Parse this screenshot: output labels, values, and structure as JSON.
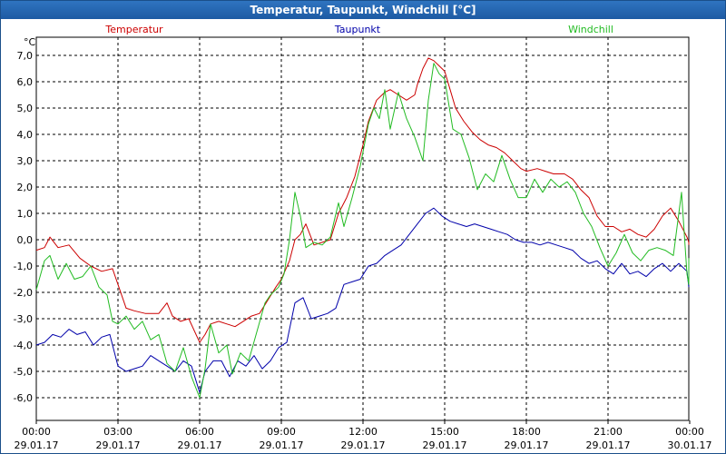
{
  "window": {
    "title": "Temperatur, Taupunkt, Windchill [°C]"
  },
  "chart_data": {
    "type": "line",
    "title": "Temperatur, Taupunkt, Windchill [°C]",
    "ylabel": "°C",
    "ylim": [
      -6.8,
      7.4
    ],
    "xlim_hours": [
      0,
      24
    ],
    "grid": true,
    "legend_position": "top",
    "y_ticks": [
      "7,0",
      "6,0",
      "5,0",
      "4,0",
      "3,0",
      "2,0",
      "1,0",
      "0,0",
      "-1,0",
      "-2,0",
      "-3,0",
      "-4,0",
      "-5,0",
      "-6,0"
    ],
    "y_tick_values": [
      7,
      6,
      5,
      4,
      3,
      2,
      1,
      0,
      -1,
      -2,
      -3,
      -4,
      -5,
      -6
    ],
    "x_ticks": [
      {
        "time": "00:00",
        "date": "29.01.17"
      },
      {
        "time": "03:00",
        "date": "29.01.17"
      },
      {
        "time": "06:00",
        "date": "29.01.17"
      },
      {
        "time": "09:00",
        "date": "29.01.17"
      },
      {
        "time": "12:00",
        "date": "29.01.17"
      },
      {
        "time": "15:00",
        "date": "29.01.17"
      },
      {
        "time": "18:00",
        "date": "29.01.17"
      },
      {
        "time": "21:00",
        "date": "29.01.17"
      },
      {
        "time": "00:00",
        "date": "30.01.17"
      }
    ],
    "series": [
      {
        "name": "Temperatur",
        "color": "#cc0000",
        "points": [
          [
            0,
            -0.4
          ],
          [
            0.3,
            -0.3
          ],
          [
            0.5,
            0.1
          ],
          [
            0.8,
            -0.3
          ],
          [
            1.2,
            -0.2
          ],
          [
            1.6,
            -0.7
          ],
          [
            2,
            -1
          ],
          [
            2.4,
            -1.2
          ],
          [
            2.8,
            -1.1
          ],
          [
            3,
            -1.7
          ],
          [
            3.3,
            -2.6
          ],
          [
            3.6,
            -2.7
          ],
          [
            4,
            -2.8
          ],
          [
            4.5,
            -2.8
          ],
          [
            4.8,
            -2.4
          ],
          [
            5,
            -2.9
          ],
          [
            5.3,
            -3.1
          ],
          [
            5.6,
            -3
          ],
          [
            6,
            -3.9
          ],
          [
            6.2,
            -3.6
          ],
          [
            6.4,
            -3.2
          ],
          [
            6.7,
            -3.1
          ],
          [
            7,
            -3.2
          ],
          [
            7.3,
            -3.3
          ],
          [
            7.6,
            -3.1
          ],
          [
            7.9,
            -2.9
          ],
          [
            8.2,
            -2.8
          ],
          [
            8.5,
            -2.3
          ],
          [
            8.8,
            -1.8
          ],
          [
            9,
            -1.5
          ],
          [
            9.3,
            -0.8
          ],
          [
            9.5,
            0
          ],
          [
            9.7,
            0.2
          ],
          [
            9.9,
            0.6
          ],
          [
            10.2,
            -0.2
          ],
          [
            10.5,
            -0.1
          ],
          [
            10.8,
            0
          ],
          [
            11.1,
            1.0
          ],
          [
            11.4,
            1.6
          ],
          [
            11.7,
            2.4
          ],
          [
            12,
            3.6
          ],
          [
            12.2,
            4.5
          ],
          [
            12.5,
            5.3
          ],
          [
            12.8,
            5.6
          ],
          [
            13,
            5.7
          ],
          [
            13.3,
            5.5
          ],
          [
            13.6,
            5.3
          ],
          [
            13.9,
            5.5
          ],
          [
            14,
            5.9
          ],
          [
            14.2,
            6.5
          ],
          [
            14.4,
            6.9
          ],
          [
            14.6,
            6.8
          ],
          [
            14.8,
            6.6
          ],
          [
            15,
            6.4
          ],
          [
            15.2,
            5.7
          ],
          [
            15.4,
            5.0
          ],
          [
            15.7,
            4.5
          ],
          [
            16,
            4.1
          ],
          [
            16.3,
            3.8
          ],
          [
            16.6,
            3.6
          ],
          [
            16.9,
            3.5
          ],
          [
            17.2,
            3.3
          ],
          [
            17.5,
            3.0
          ],
          [
            17.8,
            2.7
          ],
          [
            18,
            2.6
          ],
          [
            18.4,
            2.7
          ],
          [
            18.7,
            2.6
          ],
          [
            19,
            2.5
          ],
          [
            19.4,
            2.5
          ],
          [
            19.7,
            2.3
          ],
          [
            20,
            1.9
          ],
          [
            20.3,
            1.6
          ],
          [
            20.6,
            0.9
          ],
          [
            20.9,
            0.5
          ],
          [
            21.2,
            0.5
          ],
          [
            21.5,
            0.3
          ],
          [
            21.8,
            0.4
          ],
          [
            22.1,
            0.2
          ],
          [
            22.4,
            0.1
          ],
          [
            22.7,
            0.4
          ],
          [
            23,
            0.9
          ],
          [
            23.3,
            1.2
          ],
          [
            23.6,
            0.7
          ],
          [
            23.9,
            0.1
          ],
          [
            24.1,
            -0.1
          ],
          [
            24.4,
            -0.2
          ]
        ]
      },
      {
        "name": "Taupunkt",
        "color": "#0000aa",
        "points": [
          [
            0,
            -4
          ],
          [
            0.3,
            -3.9
          ],
          [
            0.6,
            -3.6
          ],
          [
            0.9,
            -3.7
          ],
          [
            1.2,
            -3.4
          ],
          [
            1.5,
            -3.6
          ],
          [
            1.8,
            -3.5
          ],
          [
            2.1,
            -4
          ],
          [
            2.4,
            -3.7
          ],
          [
            2.7,
            -3.6
          ],
          [
            3,
            -4.8
          ],
          [
            3.3,
            -5
          ],
          [
            3.6,
            -4.9
          ],
          [
            3.9,
            -4.8
          ],
          [
            4.2,
            -4.4
          ],
          [
            4.5,
            -4.6
          ],
          [
            4.8,
            -4.8
          ],
          [
            5.1,
            -5.0
          ],
          [
            5.4,
            -4.6
          ],
          [
            5.7,
            -4.8
          ],
          [
            6,
            -5.8
          ],
          [
            6.2,
            -5.0
          ],
          [
            6.5,
            -4.6
          ],
          [
            6.8,
            -4.6
          ],
          [
            7.1,
            -5.2
          ],
          [
            7.4,
            -4.6
          ],
          [
            7.7,
            -4.8
          ],
          [
            8,
            -4.4
          ],
          [
            8.3,
            -4.9
          ],
          [
            8.6,
            -4.6
          ],
          [
            8.9,
            -4.1
          ],
          [
            9.2,
            -3.9
          ],
          [
            9.5,
            -2.4
          ],
          [
            9.8,
            -2.2
          ],
          [
            10.1,
            -3.0
          ],
          [
            10.4,
            -2.9
          ],
          [
            10.7,
            -2.8
          ],
          [
            11,
            -2.6
          ],
          [
            11.3,
            -1.7
          ],
          [
            11.6,
            -1.6
          ],
          [
            11.9,
            -1.5
          ],
          [
            12.2,
            -1.0
          ],
          [
            12.5,
            -0.9
          ],
          [
            12.8,
            -0.6
          ],
          [
            13.1,
            -0.4
          ],
          [
            13.4,
            -0.2
          ],
          [
            13.7,
            0.2
          ],
          [
            14,
            0.6
          ],
          [
            14.3,
            1.0
          ],
          [
            14.6,
            1.2
          ],
          [
            14.9,
            0.9
          ],
          [
            15.2,
            0.7
          ],
          [
            15.5,
            0.6
          ],
          [
            15.8,
            0.5
          ],
          [
            16.1,
            0.6
          ],
          [
            16.4,
            0.5
          ],
          [
            16.7,
            0.4
          ],
          [
            17,
            0.3
          ],
          [
            17.3,
            0.2
          ],
          [
            17.6,
            0.0
          ],
          [
            17.9,
            -0.1
          ],
          [
            18.2,
            -0.1
          ],
          [
            18.5,
            -0.2
          ],
          [
            18.8,
            -0.1
          ],
          [
            19.1,
            -0.2
          ],
          [
            19.4,
            -0.3
          ],
          [
            19.7,
            -0.4
          ],
          [
            20,
            -0.7
          ],
          [
            20.3,
            -0.9
          ],
          [
            20.6,
            -0.8
          ],
          [
            20.9,
            -1.1
          ],
          [
            21.2,
            -1.3
          ],
          [
            21.5,
            -0.9
          ],
          [
            21.8,
            -1.3
          ],
          [
            22.1,
            -1.2
          ],
          [
            22.4,
            -1.4
          ],
          [
            22.7,
            -1.1
          ],
          [
            23,
            -0.9
          ],
          [
            23.3,
            -1.2
          ],
          [
            23.6,
            -0.9
          ],
          [
            23.9,
            -1.2
          ],
          [
            24.1,
            -1.8
          ],
          [
            24.4,
            -1.8
          ]
        ]
      },
      {
        "name": "Windchill",
        "color": "#22bb22",
        "points": [
          [
            0,
            -1.9
          ],
          [
            0.3,
            -0.8
          ],
          [
            0.5,
            -0.6
          ],
          [
            0.8,
            -1.5
          ],
          [
            1.1,
            -0.9
          ],
          [
            1.4,
            -1.5
          ],
          [
            1.7,
            -1.4
          ],
          [
            2,
            -1.0
          ],
          [
            2.3,
            -1.8
          ],
          [
            2.6,
            -2.1
          ],
          [
            2.8,
            -3.1
          ],
          [
            3,
            -3.2
          ],
          [
            3.3,
            -2.9
          ],
          [
            3.6,
            -3.4
          ],
          [
            3.9,
            -3.1
          ],
          [
            4.2,
            -3.8
          ],
          [
            4.5,
            -3.6
          ],
          [
            4.8,
            -4.7
          ],
          [
            5.1,
            -5.0
          ],
          [
            5.4,
            -4.1
          ],
          [
            5.7,
            -5.2
          ],
          [
            6,
            -6.0
          ],
          [
            6.2,
            -4.9
          ],
          [
            6.4,
            -3.2
          ],
          [
            6.7,
            -4.3
          ],
          [
            7,
            -4.0
          ],
          [
            7.2,
            -5.1
          ],
          [
            7.5,
            -4.3
          ],
          [
            7.8,
            -4.6
          ],
          [
            8.1,
            -3.5
          ],
          [
            8.4,
            -2.4
          ],
          [
            8.6,
            -2.1
          ],
          [
            8.9,
            -1.8
          ],
          [
            9.1,
            -1.3
          ],
          [
            9.3,
            0.0
          ],
          [
            9.5,
            1.8
          ],
          [
            9.7,
            0.9
          ],
          [
            9.9,
            -0.3
          ],
          [
            10.2,
            -0.1
          ],
          [
            10.5,
            -0.2
          ],
          [
            10.8,
            0.1
          ],
          [
            11.1,
            1.4
          ],
          [
            11.3,
            0.5
          ],
          [
            11.6,
            1.6
          ],
          [
            11.9,
            2.8
          ],
          [
            12.2,
            4.4
          ],
          [
            12.4,
            5.0
          ],
          [
            12.6,
            4.6
          ],
          [
            12.8,
            5.7
          ],
          [
            13,
            4.2
          ],
          [
            13.3,
            5.6
          ],
          [
            13.6,
            4.6
          ],
          [
            13.9,
            3.9
          ],
          [
            14.2,
            3.0
          ],
          [
            14.4,
            5.3
          ],
          [
            14.6,
            6.7
          ],
          [
            14.8,
            6.3
          ],
          [
            15,
            6.1
          ],
          [
            15.3,
            4.2
          ],
          [
            15.6,
            4.0
          ],
          [
            15.9,
            3.1
          ],
          [
            16.2,
            1.9
          ],
          [
            16.5,
            2.5
          ],
          [
            16.8,
            2.2
          ],
          [
            17.1,
            3.2
          ],
          [
            17.4,
            2.3
          ],
          [
            17.7,
            1.6
          ],
          [
            18,
            1.6
          ],
          [
            18.3,
            2.3
          ],
          [
            18.6,
            1.8
          ],
          [
            18.9,
            2.3
          ],
          [
            19.2,
            2.0
          ],
          [
            19.5,
            2.2
          ],
          [
            19.8,
            1.8
          ],
          [
            20.1,
            1.0
          ],
          [
            20.4,
            0.5
          ],
          [
            20.7,
            -0.3
          ],
          [
            21,
            -1.0
          ],
          [
            21.3,
            -0.5
          ],
          [
            21.6,
            0.2
          ],
          [
            21.9,
            -0.5
          ],
          [
            22.2,
            -0.8
          ],
          [
            22.5,
            -0.4
          ],
          [
            22.8,
            -0.3
          ],
          [
            23.1,
            -0.4
          ],
          [
            23.4,
            -0.6
          ],
          [
            23.7,
            1.8
          ],
          [
            23.9,
            -1.3
          ],
          [
            24.1,
            -1.7
          ],
          [
            24.4,
            -0.7
          ]
        ]
      }
    ]
  }
}
